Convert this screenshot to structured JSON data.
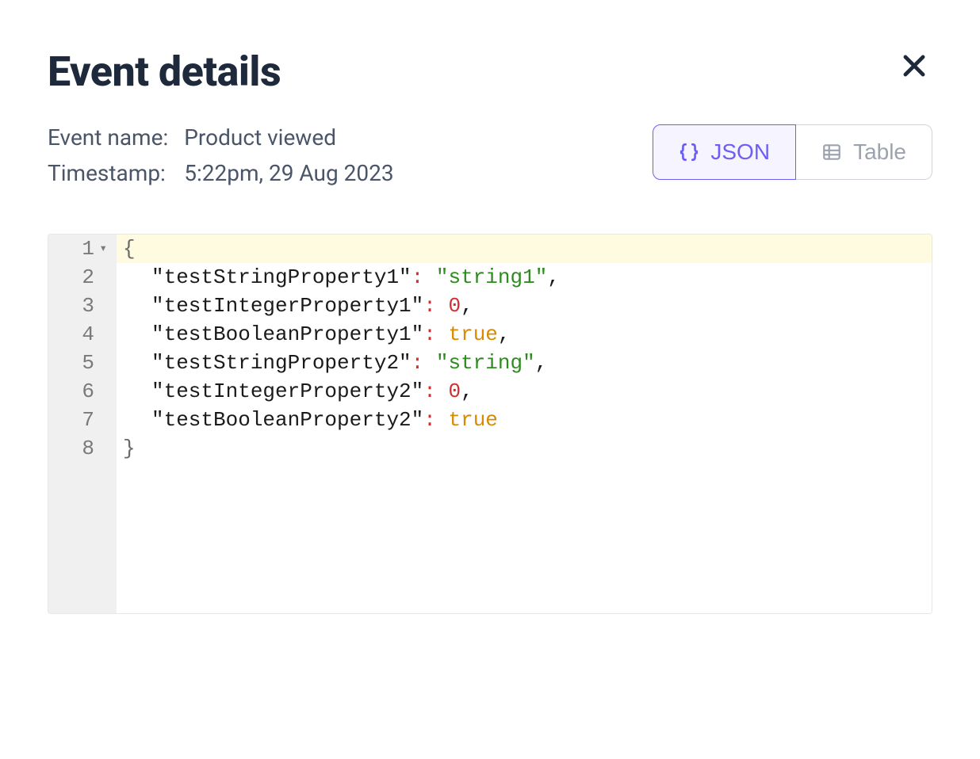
{
  "header": {
    "title": "Event details"
  },
  "meta": {
    "event_name_label": "Event name:",
    "event_name_value": "Product viewed",
    "timestamp_label": "Timestamp:",
    "timestamp_value": "5:22pm, 29 Aug 2023"
  },
  "toggle": {
    "json_label": "JSON",
    "table_label": "Table"
  },
  "code": {
    "lines": [
      {
        "n": "1",
        "type": "open",
        "text": "{"
      },
      {
        "n": "2",
        "type": "kv",
        "key": "\"testStringProperty1\"",
        "val": "\"string1\"",
        "valtype": "string",
        "comma": ","
      },
      {
        "n": "3",
        "type": "kv",
        "key": "\"testIntegerProperty1\"",
        "val": "0",
        "valtype": "number",
        "comma": ","
      },
      {
        "n": "4",
        "type": "kv",
        "key": "\"testBooleanProperty1\"",
        "val": "true",
        "valtype": "bool",
        "comma": ","
      },
      {
        "n": "5",
        "type": "kv",
        "key": "\"testStringProperty2\"",
        "val": "\"string\"",
        "valtype": "string",
        "comma": ","
      },
      {
        "n": "6",
        "type": "kv",
        "key": "\"testIntegerProperty2\"",
        "val": "0",
        "valtype": "number",
        "comma": ","
      },
      {
        "n": "7",
        "type": "kv",
        "key": "\"testBooleanProperty2\"",
        "val": "true",
        "valtype": "bool",
        "comma": ""
      },
      {
        "n": "8",
        "type": "close",
        "text": "}"
      }
    ]
  }
}
